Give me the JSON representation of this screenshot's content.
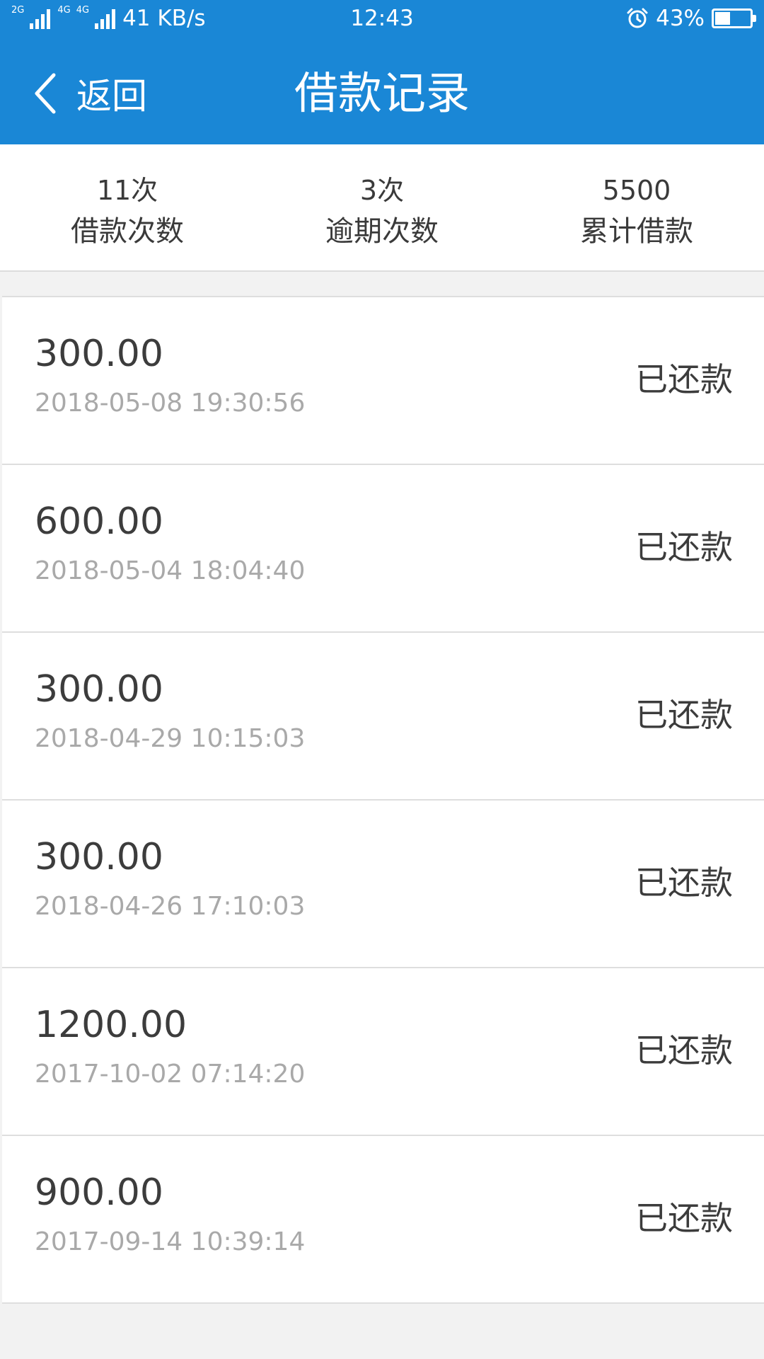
{
  "status_bar": {
    "network_tag_1": "2G",
    "network_tag_2": "4G",
    "network_tag_3": "4G",
    "speed": "41 KB/s",
    "time": "12:43",
    "battery_percent": "43%",
    "battery_level": 0.43,
    "icons": [
      "signal-icon",
      "alarm-icon",
      "battery-icon"
    ]
  },
  "title_bar": {
    "back_label": "返回",
    "title": "借款记录",
    "background_color": "#1a87d6"
  },
  "summary": {
    "items": [
      {
        "value": "11次",
        "label": "借款次数"
      },
      {
        "value": "3次",
        "label": "逾期次数"
      },
      {
        "value": "5500",
        "label": "累计借款"
      }
    ]
  },
  "records": [
    {
      "amount": "300.00",
      "time": "2018-05-08 19:30:56",
      "status": "已还款"
    },
    {
      "amount": "600.00",
      "time": "2018-05-04 18:04:40",
      "status": "已还款"
    },
    {
      "amount": "300.00",
      "time": "2018-04-29 10:15:03",
      "status": "已还款"
    },
    {
      "amount": "300.00",
      "time": "2018-04-26 17:10:03",
      "status": "已还款"
    },
    {
      "amount": "1200.00",
      "time": "2017-10-02 07:14:20",
      "status": "已还款"
    },
    {
      "amount": "900.00",
      "time": "2017-09-14 10:39:14",
      "status": "已还款"
    }
  ]
}
